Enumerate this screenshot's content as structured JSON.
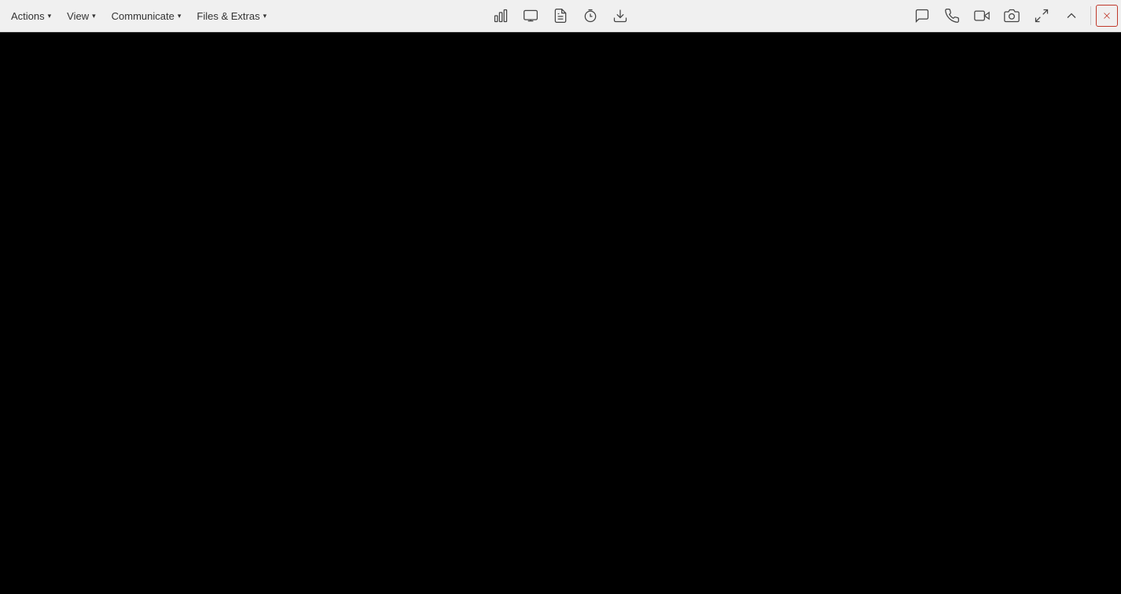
{
  "toolbar": {
    "menus": [
      {
        "id": "actions",
        "label": "Actions",
        "has_chevron": true
      },
      {
        "id": "view",
        "label": "View",
        "has_chevron": true
      },
      {
        "id": "communicate",
        "label": "Communicate",
        "has_chevron": true
      },
      {
        "id": "files-extras",
        "label": "Files & Extras",
        "has_chevron": true
      }
    ],
    "center_icons": [
      {
        "id": "stats",
        "title": "Statistics"
      },
      {
        "id": "screen",
        "title": "Screen"
      },
      {
        "id": "files",
        "title": "Files"
      },
      {
        "id": "timer",
        "title": "Timer"
      },
      {
        "id": "download",
        "title": "Download"
      }
    ],
    "right_icons": [
      {
        "id": "chat",
        "title": "Chat"
      },
      {
        "id": "phone",
        "title": "Phone"
      },
      {
        "id": "video",
        "title": "Video"
      },
      {
        "id": "camera",
        "title": "Camera"
      },
      {
        "id": "fullscreen",
        "title": "Fullscreen"
      },
      {
        "id": "arrow-up",
        "title": "Scroll Up"
      },
      {
        "id": "close",
        "title": "Close"
      }
    ]
  },
  "main": {
    "background": "#000000"
  }
}
